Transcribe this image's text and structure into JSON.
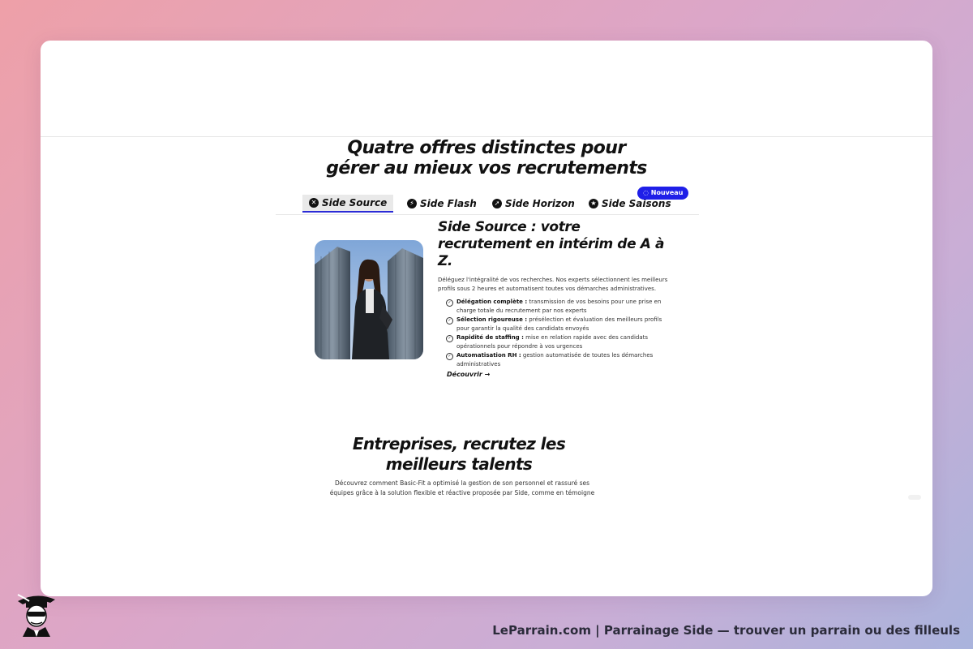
{
  "section_offers": {
    "title_line1": "Quatre offres distinctes pour",
    "title_line2": "gérer au mieux vos recrutements"
  },
  "tabs": [
    {
      "label": "Side Source",
      "icon": "source-icon",
      "active": true
    },
    {
      "label": "Side Flash",
      "icon": "lightning-icon",
      "active": false
    },
    {
      "label": "Side Horizon",
      "icon": "compass-icon",
      "active": false
    },
    {
      "label": "Side Saisons",
      "icon": "star-icon",
      "active": false
    }
  ],
  "new_badge": "Nouveau",
  "offer": {
    "title": "Side Source : votre recrutement en intérim de A à Z.",
    "description": "Déléguez l'intégralité de vos recherches. Nos experts sélectionnent les meilleurs profils sous 2 heures et automatisent toutes vos démarches administratives.",
    "features": [
      {
        "title": "Délégation complète :",
        "text": " transmission de vos besoins pour une prise en charge totale du recrutement par nos experts"
      },
      {
        "title": "Sélection rigoureuse :",
        "text": " présélection et évaluation des meilleurs profils pour garantir la qualité des candidats envoyés"
      },
      {
        "title": "Rapidité de staffing :",
        "text": " mise en relation rapide avec des candidats opérationnels pour répondre à vos urgences"
      },
      {
        "title": "Automatisation RH :",
        "text": " gestion automatisée de toutes les démarches administratives"
      }
    ],
    "cta": "Découvrir →"
  },
  "section_companies": {
    "title_line1": "Entreprises, recrutez les",
    "title_line2": "meilleurs talents",
    "text": "Découvrez comment Basic-Fit a optimisé la gestion de son personnel et rassuré ses équipes grâce à la solution flexible et réactive proposée par Side, comme en témoigne"
  },
  "footer": {
    "caption": "LeParrain.com | Parrainage Side — trouver un parrain ou des filleuls"
  },
  "colors": {
    "accent": "#1f1fe8",
    "text": "#111111"
  }
}
